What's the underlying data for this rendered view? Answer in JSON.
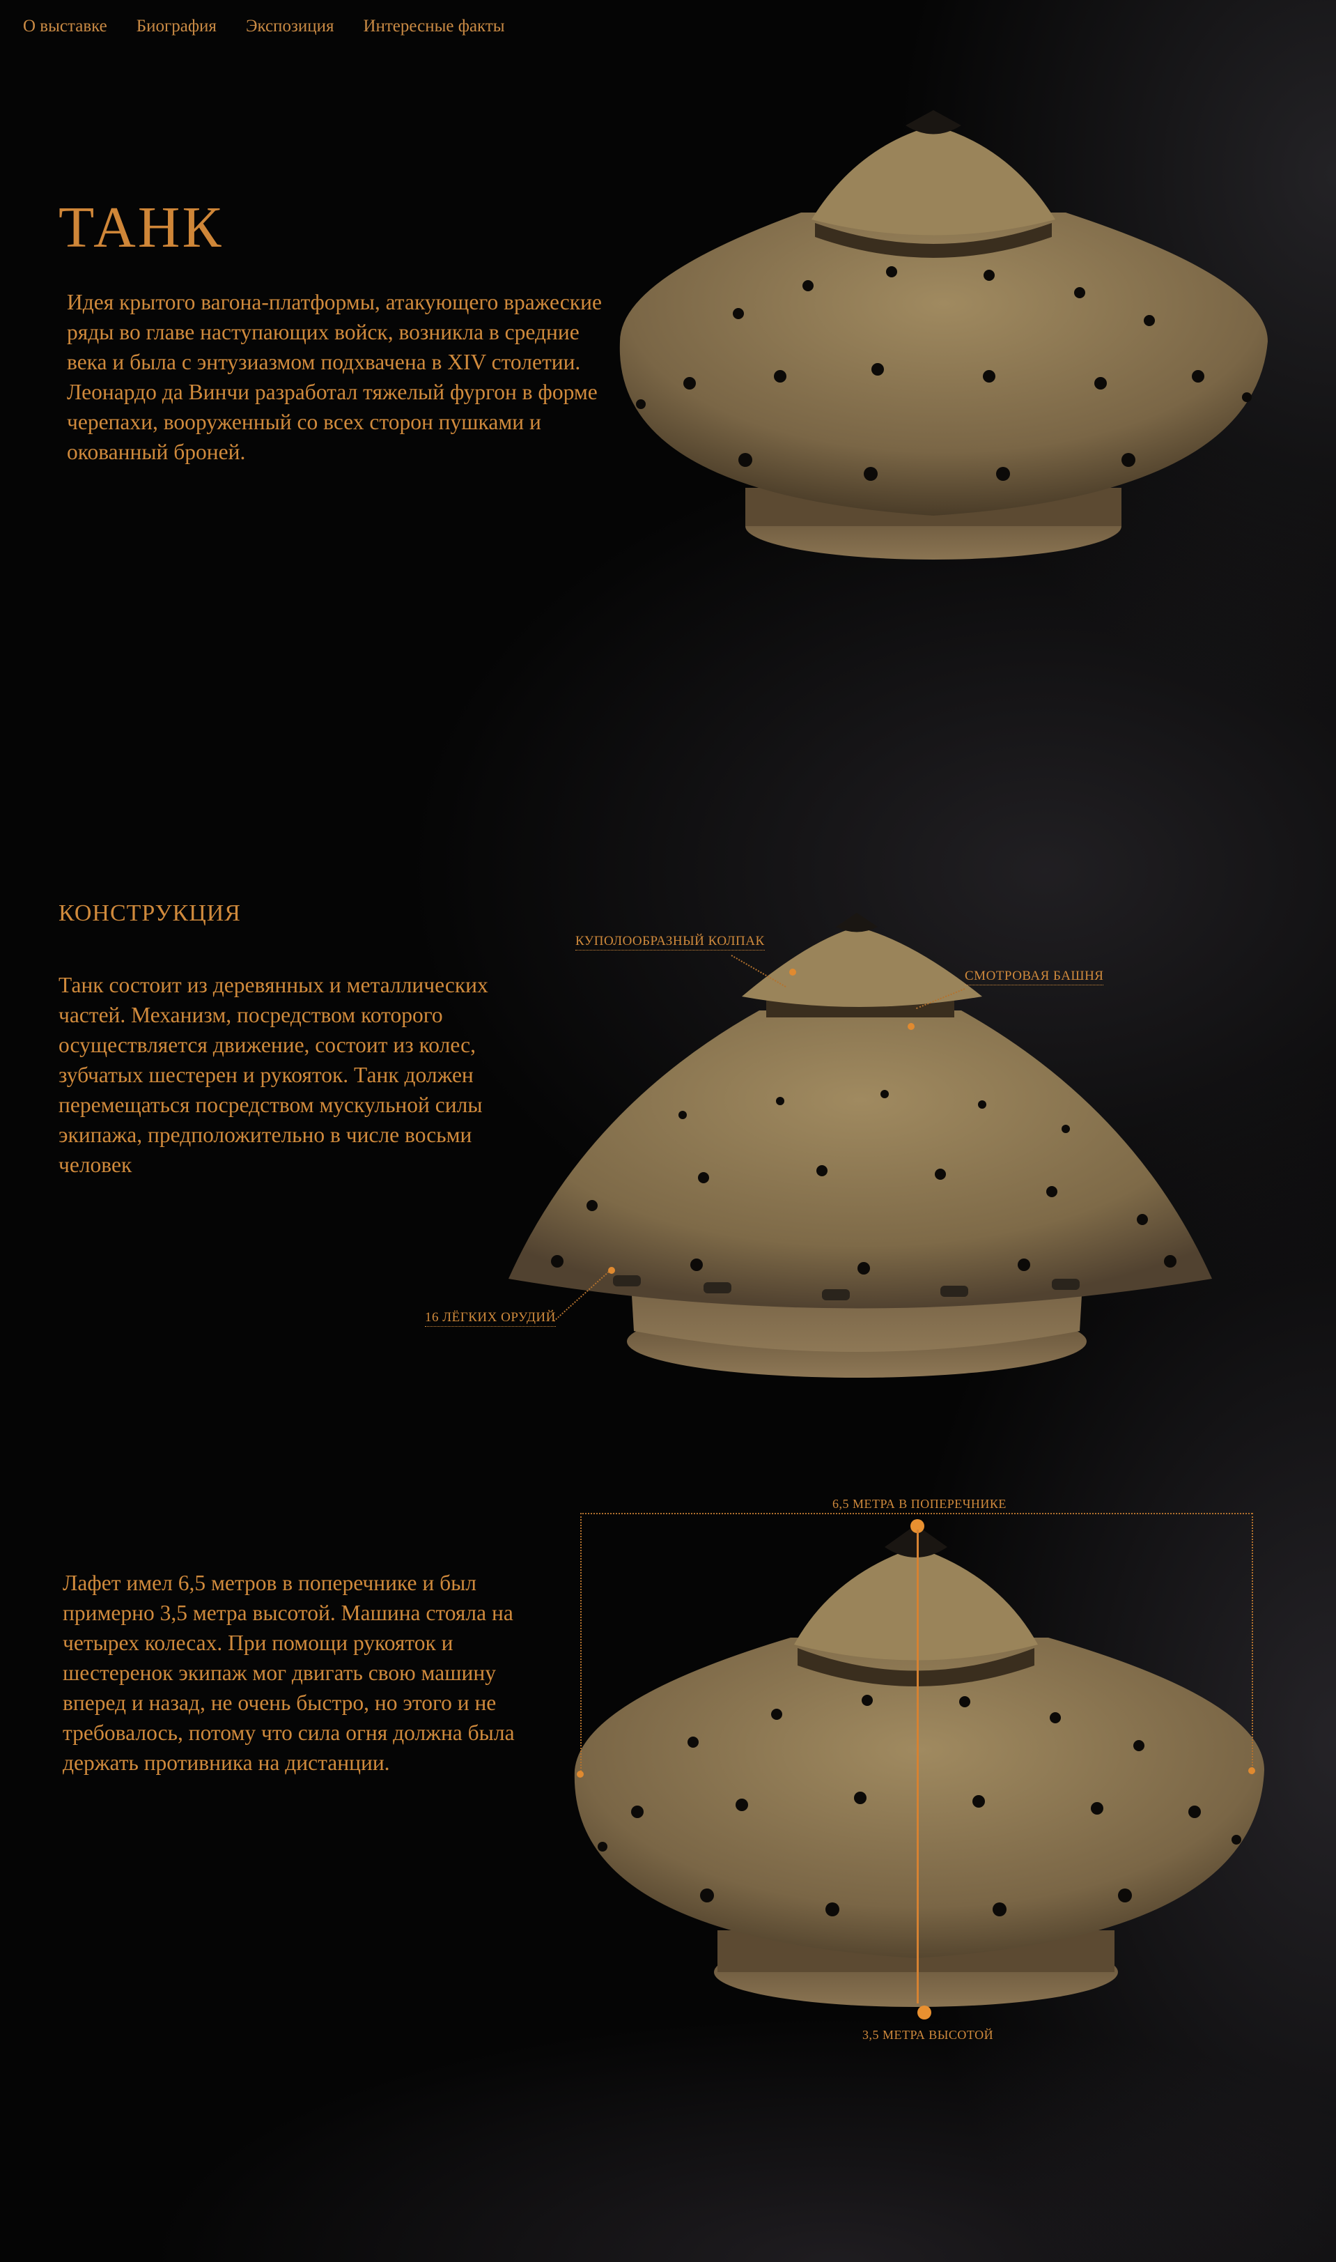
{
  "nav": {
    "items": [
      "О выставке",
      "Биография",
      "Экспозиция",
      "Интересные факты"
    ]
  },
  "hero": {
    "title": "ТАНК",
    "text": "Идея крытого вагона-платформы, атакующего вражеские ряды во главе наступающих войск, возникла в средние века и была с энтузиазмом подхвачена в XIV столетии. Леонардо да Винчи разработал тяжелый фургон в форме черепахи, вооруженный со всех сторон пушками и окованный броней."
  },
  "construction": {
    "title": "КОНСТРУКЦИЯ",
    "text": "Танк состоит из деревянных и металлических частей. Механизм, посредством которого осуществляется движение, состоит из колес, зубчатых шестерен и рукояток. Танк должен перемещаться посредством мускульной силы экипажа, предположительно в числе восьми человек",
    "callouts": {
      "dome": "КУПОЛООБРАЗНЫЙ КОЛПАК",
      "tower": "СМОТРОВАЯ БАШНЯ",
      "guns": "16 ЛЁГКИХ ОРУДИЙ"
    }
  },
  "dimensions": {
    "text": "Лафет имел 6,5 метров в поперечнике и был примерно 3,5 метра высотой. Машина стояла на четырех колесах. При помощи рукояток и шестеренок экипаж мог двигать свою машину вперед и назад, не очень быстро, но этого и не требовалось, потому что сила огня должна была держать противника на дистанции.",
    "width_label": "6,5 МЕТРА В ПОПЕРЕЧНИКЕ",
    "height_label": "3,5 МЕТРА ВЫСОТОЙ"
  },
  "colors": {
    "accent": "#d08a3c",
    "background": "#050505",
    "wood": "#8a7550"
  }
}
